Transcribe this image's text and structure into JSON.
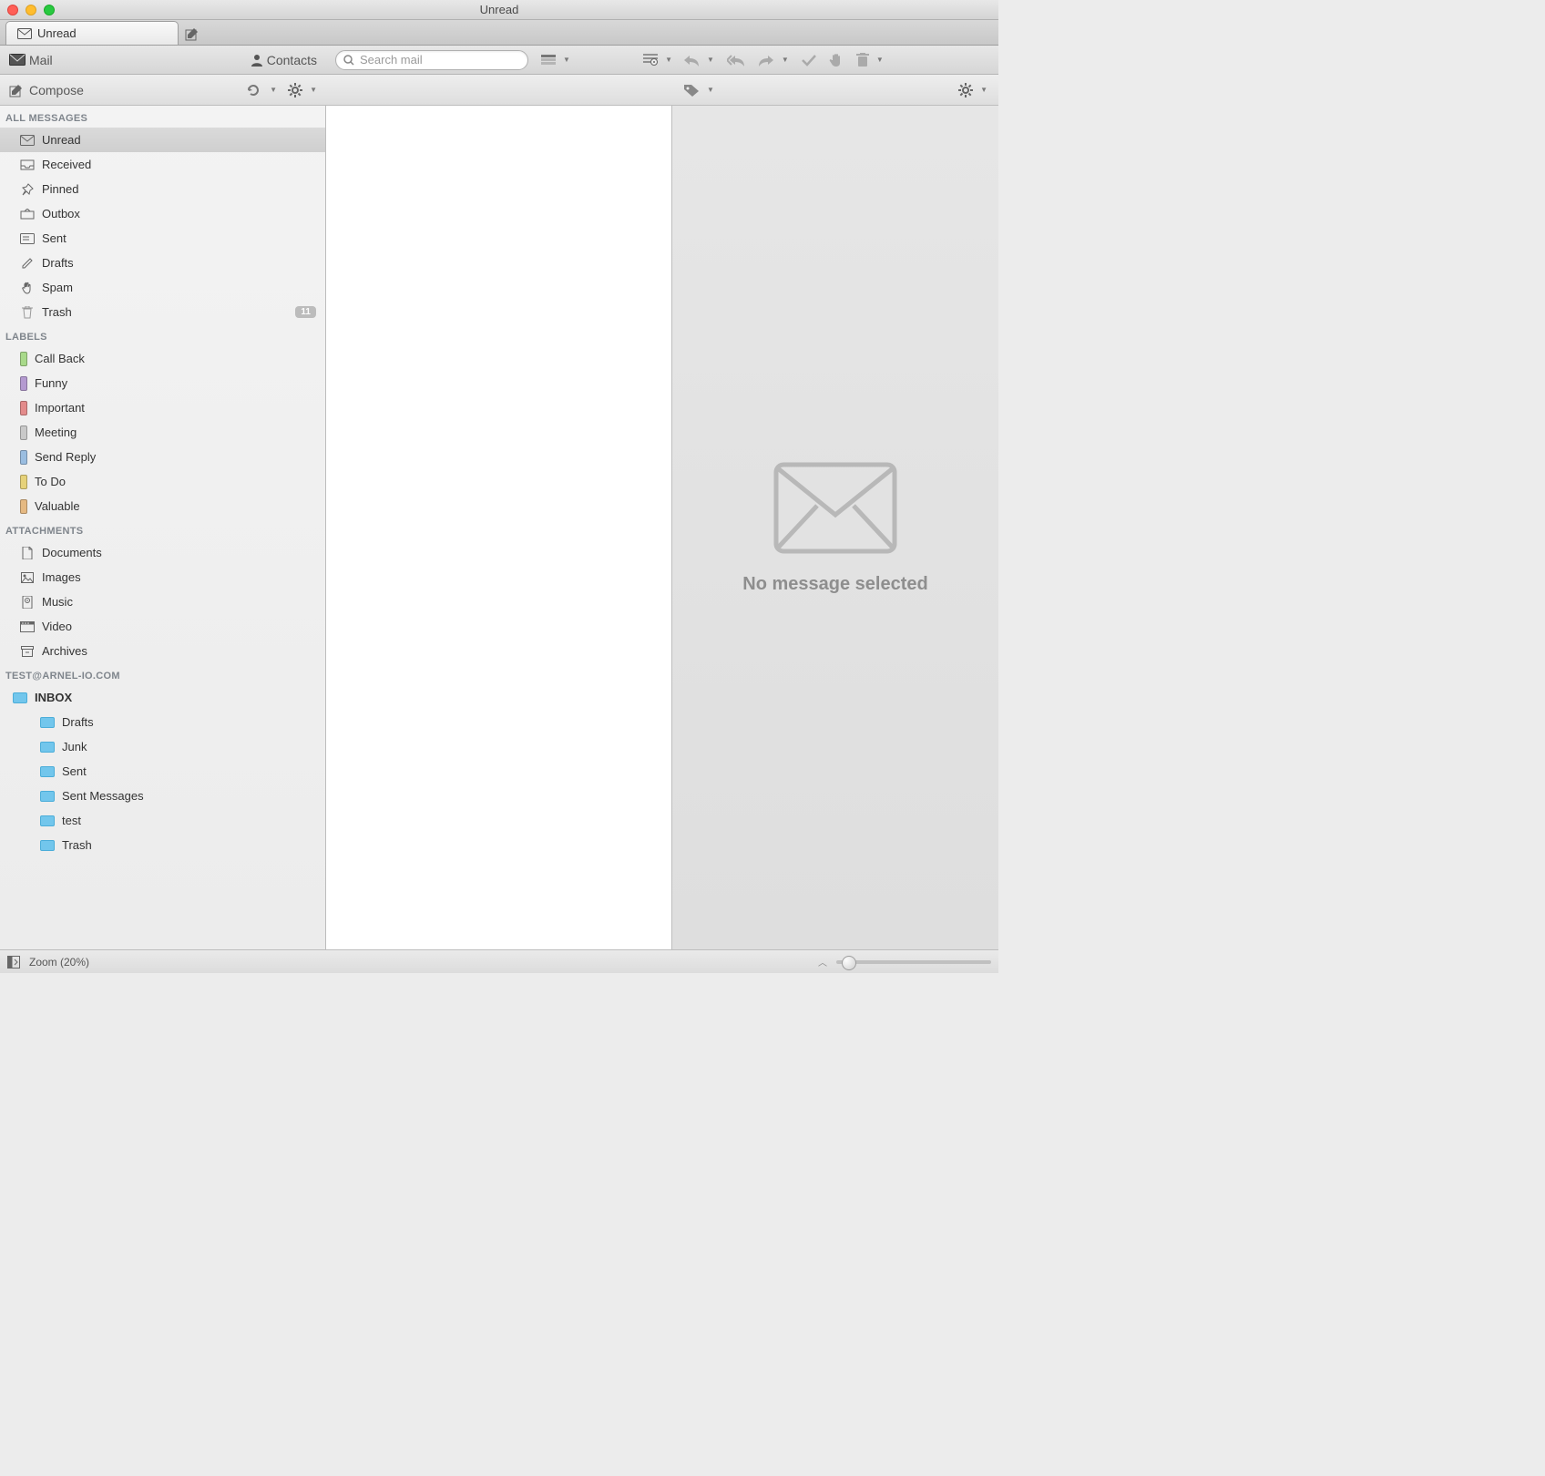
{
  "window": {
    "title": "Unread"
  },
  "tabs": {
    "active_label": "Unread"
  },
  "toolbar": {
    "mail_label": "Mail",
    "contacts_label": "Contacts",
    "search_placeholder": "Search mail"
  },
  "subtoolbar": {
    "compose_label": "Compose"
  },
  "sidebar": {
    "groups": {
      "all_messages": {
        "header": "ALL MESSAGES",
        "items": [
          {
            "label": "Unread",
            "icon": "envelope",
            "selected": true
          },
          {
            "label": "Received",
            "icon": "inbox"
          },
          {
            "label": "Pinned",
            "icon": "pin"
          },
          {
            "label": "Outbox",
            "icon": "outbox"
          },
          {
            "label": "Sent",
            "icon": "sent"
          },
          {
            "label": "Drafts",
            "icon": "pencil"
          },
          {
            "label": "Spam",
            "icon": "hand"
          },
          {
            "label": "Trash",
            "icon": "trash",
            "count": "11"
          }
        ]
      },
      "labels": {
        "header": "LABELS",
        "items": [
          {
            "label": "Call Back",
            "color": "#a8d98a"
          },
          {
            "label": "Funny",
            "color": "#b49ad0"
          },
          {
            "label": "Important",
            "color": "#e38b8b"
          },
          {
            "label": "Meeting",
            "color": "#c9c9c9"
          },
          {
            "label": "Send Reply",
            "color": "#9abde0"
          },
          {
            "label": "To Do",
            "color": "#e6d27a"
          },
          {
            "label": "Valuable",
            "color": "#e5b982"
          }
        ]
      },
      "attachments": {
        "header": "ATTACHMENTS",
        "items": [
          {
            "label": "Documents",
            "icon": "doc"
          },
          {
            "label": "Images",
            "icon": "image"
          },
          {
            "label": "Music",
            "icon": "music"
          },
          {
            "label": "Video",
            "icon": "video"
          },
          {
            "label": "Archives",
            "icon": "archive"
          }
        ]
      },
      "account": {
        "header": "TEST@ARNEL-IO.COM",
        "inbox_label": "INBOX",
        "subfolders": [
          {
            "label": "Drafts"
          },
          {
            "label": "Junk"
          },
          {
            "label": "Sent"
          },
          {
            "label": "Sent Messages"
          },
          {
            "label": "test"
          },
          {
            "label": "Trash"
          }
        ]
      }
    }
  },
  "reading": {
    "empty_text": "No message selected"
  },
  "statusbar": {
    "zoom_label": "Zoom (20%)"
  }
}
